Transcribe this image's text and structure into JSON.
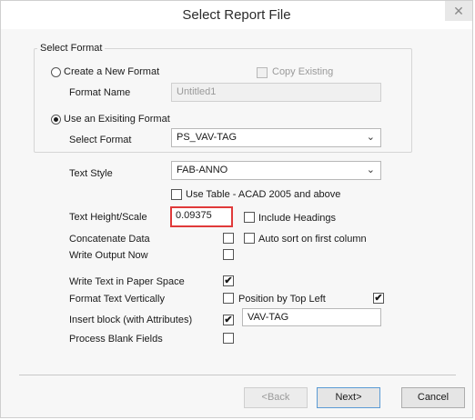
{
  "dialog": {
    "title": "Select Report File",
    "close_glyph": "✕"
  },
  "select_format": {
    "legend": "Select Format",
    "create_new": {
      "label": "Create a New Format",
      "selected": false
    },
    "copy_existing": {
      "label": "Copy Existing",
      "checked": false,
      "enabled": false
    },
    "format_name": {
      "label": "Format Name",
      "value": "Untitled1",
      "enabled": false
    },
    "use_existing": {
      "label": "Use an Exisiting Format",
      "selected": true
    },
    "select_format": {
      "label": "Select Format",
      "value": "PS_VAV-TAG"
    }
  },
  "options": {
    "text_style": {
      "label": "Text Style",
      "value": "FAB-ANNO"
    },
    "use_table": {
      "label": "Use Table - ACAD 2005 and above",
      "checked": false
    },
    "text_height": {
      "label": "Text Height/Scale",
      "value": "0.09375"
    },
    "include_headings": {
      "label": "Include Headings",
      "checked": false
    },
    "concatenate": {
      "label": "Concatenate Data",
      "checked": false
    },
    "auto_sort": {
      "label": "Auto sort on first column",
      "checked": false
    },
    "write_output": {
      "label": "Write Output Now",
      "checked": false
    },
    "write_paper_space": {
      "label": "Write Text in Paper Space",
      "checked": true
    },
    "format_vertical": {
      "label": "Format Text Vertically",
      "checked": false
    },
    "position_top_left": {
      "label": "Position by Top Left",
      "checked": true
    },
    "insert_block": {
      "label": "Insert block (with Attributes)",
      "checked": true,
      "value": "VAV-TAG"
    },
    "process_blank": {
      "label": "Process Blank Fields",
      "checked": false
    }
  },
  "buttons": {
    "back": "<Back",
    "next": "Next>",
    "cancel": "Cancel"
  },
  "glyphs": {
    "check": "✔",
    "chevron": "⌄"
  },
  "colors": {
    "highlight_border": "#e03a3a"
  }
}
